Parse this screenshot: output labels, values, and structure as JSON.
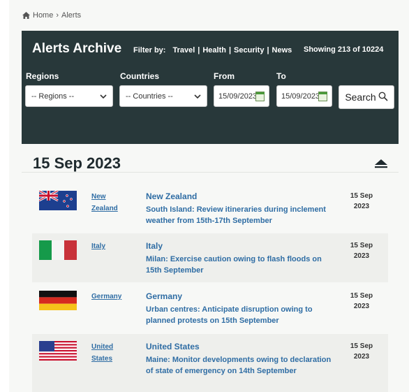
{
  "breadcrumb": {
    "home": "Home",
    "sep": "›",
    "current": "Alerts"
  },
  "archive": {
    "title": "Alerts Archive",
    "filter_label": "Filter by:",
    "filters": [
      "Travel",
      "Health",
      "Security",
      "News"
    ],
    "showing": "Showing 213 of 10224"
  },
  "form": {
    "regions_label": "Regions",
    "regions_value": "-- Regions --",
    "countries_label": "Countries",
    "countries_value": "-- Countries --",
    "from_label": "From",
    "from_value": "15/09/2023",
    "to_label": "To",
    "to_value": "15/09/2023",
    "search_label": "Search"
  },
  "date_group": "15 Sep 2023",
  "alerts": [
    {
      "country_link": "New Zealand",
      "country": "New Zealand",
      "description": "South Island: Review itineraries during inclement weather from 15th-17th September",
      "date_line1": "15 Sep",
      "date_line2": "2023",
      "flag": "new-zealand-flag"
    },
    {
      "country_link": "Italy",
      "country": "Italy",
      "description": "Milan: Exercise caution owing to flash floods on 15th September",
      "date_line1": "15 Sep",
      "date_line2": "2023",
      "flag": "italy-flag"
    },
    {
      "country_link": "Germany",
      "country": "Germany",
      "description": "Urban centres: Anticipate disruption owing to planned protests on 15th September",
      "date_line1": "15 Sep",
      "date_line2": "2023",
      "flag": "germany-flag"
    },
    {
      "country_link": "United States",
      "country": "United States",
      "description": "Maine: Monitor developments owing to declaration of state of emergency on 14th September",
      "date_line1": "15 Sep",
      "date_line2": "2023",
      "flag": "usa-flag"
    }
  ],
  "colors": {
    "panel_bg": "#28383a",
    "link": "#2f6da4",
    "row_alt": "#eeefec"
  }
}
